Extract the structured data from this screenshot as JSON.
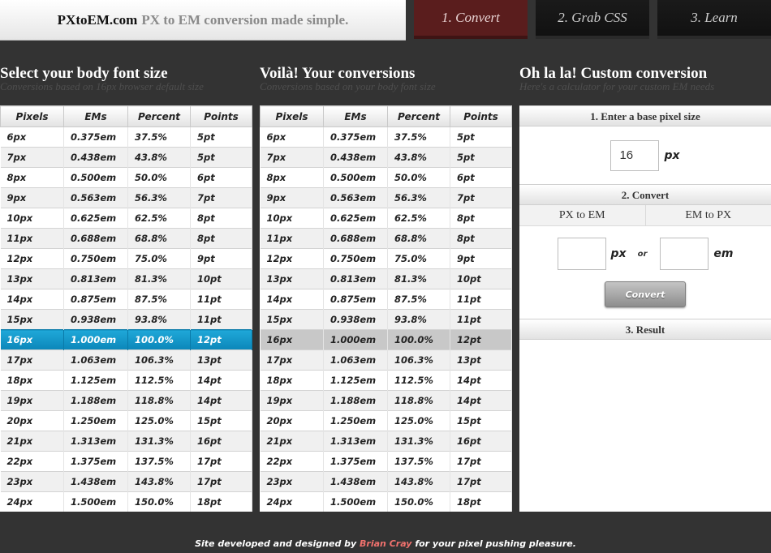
{
  "header": {
    "site_name": "PXtoEM.com",
    "tagline": "PX to EM conversion made simple.",
    "tabs": [
      "1. Convert",
      "2. Grab CSS",
      "3. Learn"
    ],
    "active_tab": 0
  },
  "columns": {
    "body": {
      "title": "Select your body font size",
      "subtitle": "Conversions based on 16px browser default size"
    },
    "voila": {
      "title": "Voilà! Your conversions",
      "subtitle": "Conversions based on your body font size"
    },
    "custom": {
      "title": "Oh la la! Custom conversion",
      "subtitle": "Here's a calculator for your custom EM needs"
    }
  },
  "table": {
    "headers": [
      "Pixels",
      "EMs",
      "Percent",
      "Points"
    ],
    "rows": [
      [
        "6px",
        "0.375em",
        "37.5%",
        "5pt"
      ],
      [
        "7px",
        "0.438em",
        "43.8%",
        "5pt"
      ],
      [
        "8px",
        "0.500em",
        "50.0%",
        "6pt"
      ],
      [
        "9px",
        "0.563em",
        "56.3%",
        "7pt"
      ],
      [
        "10px",
        "0.625em",
        "62.5%",
        "8pt"
      ],
      [
        "11px",
        "0.688em",
        "68.8%",
        "8pt"
      ],
      [
        "12px",
        "0.750em",
        "75.0%",
        "9pt"
      ],
      [
        "13px",
        "0.813em",
        "81.3%",
        "10pt"
      ],
      [
        "14px",
        "0.875em",
        "87.5%",
        "11pt"
      ],
      [
        "15px",
        "0.938em",
        "93.8%",
        "11pt"
      ],
      [
        "16px",
        "1.000em",
        "100.0%",
        "12pt"
      ],
      [
        "17px",
        "1.063em",
        "106.3%",
        "13pt"
      ],
      [
        "18px",
        "1.125em",
        "112.5%",
        "14pt"
      ],
      [
        "19px",
        "1.188em",
        "118.8%",
        "14pt"
      ],
      [
        "20px",
        "1.250em",
        "125.0%",
        "15pt"
      ],
      [
        "21px",
        "1.313em",
        "131.3%",
        "16pt"
      ],
      [
        "22px",
        "1.375em",
        "137.5%",
        "17pt"
      ],
      [
        "23px",
        "1.438em",
        "143.8%",
        "17pt"
      ],
      [
        "24px",
        "1.500em",
        "150.0%",
        "18pt"
      ]
    ],
    "selected_index": 10
  },
  "custom": {
    "step1_label": "1. Enter a base pixel size",
    "base_value": "16",
    "px_unit": "px",
    "em_unit": "em",
    "step2_label": "2. Convert",
    "px_to_em_label": "PX to EM",
    "em_to_px_label": "EM to PX",
    "or_label": "or",
    "px_value": "",
    "em_value": "",
    "convert_label": "Convert",
    "step3_label": "3. Result"
  },
  "footer": {
    "prefix": "Site developed and designed by",
    "author": "Brian Cray",
    "suffix": "for your pixel pushing pleasure."
  },
  "colors": {
    "background": "#333333",
    "active_tab": "#5a1d1d",
    "selected_row": "#1196c8",
    "highlight_row": "#c8c8c8",
    "footer_link": "#f0716d"
  }
}
